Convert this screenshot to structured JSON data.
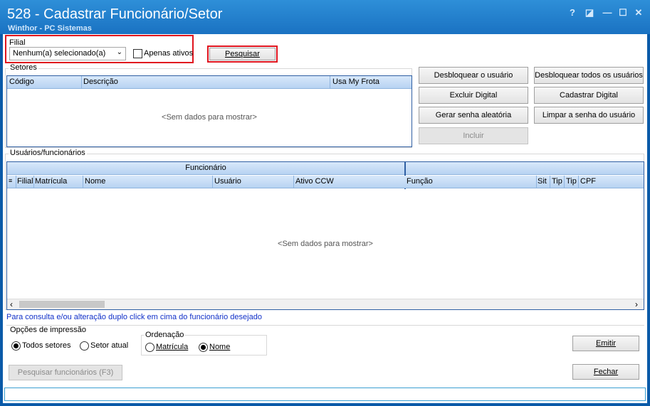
{
  "window": {
    "title": "528 - Cadastrar Funcionário/Setor",
    "subtitle": "Winthor - PC Sistemas",
    "buttons": {
      "help": "?",
      "restore": "◪",
      "minimize": "—",
      "maximize": "☐",
      "close": "✕"
    }
  },
  "filter": {
    "filial_label": "Filial",
    "filial_value": "Nenhum(a) selecionado(a)",
    "apenas_ativos_label": "Apenas ativos",
    "pesquisar_label": "Pesquisar"
  },
  "setores": {
    "title": "Setores",
    "columns": [
      "Código",
      "Descrição",
      "Usa My Frota"
    ],
    "empty_text": "<Sem dados para mostrar>"
  },
  "actions": {
    "desbloquear_usuario": "Desbloquear o usuário",
    "desbloquear_todos": "Desbloquear todos os usuários",
    "excluir_digital": "Excluir Digital",
    "cadastrar_digital": "Cadastrar Digital",
    "gerar_senha": "Gerar senha aleatória",
    "limpar_senha": "Limpar a senha do usuário",
    "incluir": "Incluir"
  },
  "usuarios": {
    "title": "Usuários/funcionários",
    "band": "Funcionário",
    "columns": [
      "Filial",
      "Matrícula",
      "Nome",
      "Usuário",
      "Ativo CCW",
      "Função",
      "Sit",
      "Tip",
      "Tip",
      "CPF"
    ],
    "empty_text": "<Sem dados para mostrar>"
  },
  "hint": "Para consulta e/ou alteração duplo click em cima do funcionário desejado",
  "opcoes": {
    "title": "Opções de impressão",
    "todos_setores": "Todos setores",
    "setor_atual": "Setor atual"
  },
  "ordenacao": {
    "title": "Ordenação",
    "matricula": "Matrícula",
    "nome": "Nome"
  },
  "bottom": {
    "pesquisar_funcionarios": "Pesquisar funcionários (F3)",
    "emitir": "Emitir",
    "fechar": "Fechar"
  },
  "colors": {
    "title_bar": "#1a72c2",
    "highlight_red": "#e0141e",
    "grid_header": "#b7d3f2",
    "hint_blue": "#1030c8"
  }
}
